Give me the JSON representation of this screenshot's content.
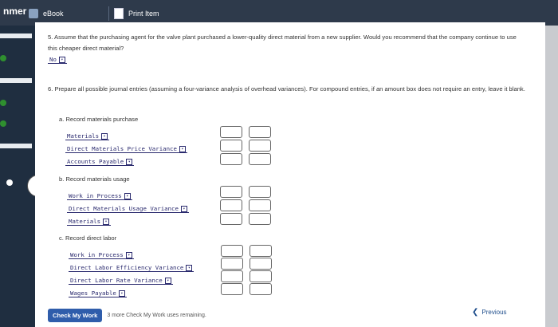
{
  "app": {
    "title": "nmer"
  },
  "tabs": [
    {
      "label": "eBook"
    },
    {
      "label": "Print Item"
    }
  ],
  "question5": {
    "text": "5. Assume that the purchasing agent for the valve plant purchased a lower-quality direct material from a new supplier. Would you recommend that the company continue to use this cheaper direct material?",
    "answer": "No"
  },
  "question6": {
    "text": "6. Prepare all possible journal entries (assuming a four-variance analysis of overhead variances). For compound entries, if an amount box does not require an entry, leave it blank.",
    "sections": [
      {
        "label": "a. Record materials purchase",
        "accounts": [
          "Materials",
          "Direct Materials Price Variance",
          "Accounts Payable"
        ]
      },
      {
        "label": "b. Record materials usage",
        "accounts": [
          "Work in Process",
          "Direct Materials Usage Variance",
          "Materials"
        ]
      },
      {
        "label": "c. Record direct labor",
        "accounts": [
          "Work in Process",
          "Direct Labor Efficiency Variance",
          "Direct Labor Rate Variance",
          "Wages Payable"
        ]
      }
    ]
  },
  "footer": {
    "check_label": "Check My Work",
    "remaining_text": "3 more Check My Work uses remaining.",
    "previous_label": "Previous"
  },
  "icons": {
    "back": "chevron-left-icon",
    "previous": "chevron-left-icon",
    "ebook": "book-icon",
    "print": "print-icon"
  }
}
